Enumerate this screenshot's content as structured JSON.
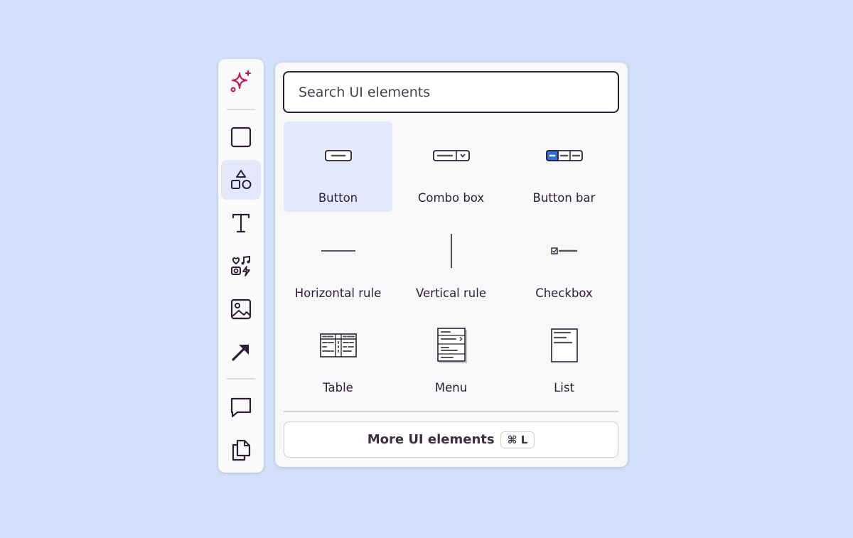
{
  "toolbar": {
    "tools": [
      {
        "name": "ai-sparkle",
        "icon": "sparkle-icon",
        "color": "#c2185b"
      },
      {
        "name": "rectangle",
        "icon": "square-icon"
      },
      {
        "name": "shapes",
        "icon": "shapes-icon",
        "active": true
      },
      {
        "name": "text",
        "icon": "text-icon"
      },
      {
        "name": "stickers",
        "icon": "stickers-icon"
      },
      {
        "name": "image",
        "icon": "image-icon"
      },
      {
        "name": "arrow",
        "icon": "arrow-icon"
      },
      {
        "name": "comment",
        "icon": "comment-icon"
      },
      {
        "name": "duplicate",
        "icon": "copy-icon"
      }
    ]
  },
  "panel": {
    "search_placeholder": "Search UI elements",
    "items": [
      {
        "label": "Button",
        "icon": "button-icon",
        "selected": true
      },
      {
        "label": "Combo box",
        "icon": "combo-box-icon"
      },
      {
        "label": "Button bar",
        "icon": "button-bar-icon"
      },
      {
        "label": "Horizontal rule",
        "icon": "horizontal-rule-icon"
      },
      {
        "label": "Vertical rule",
        "icon": "vertical-rule-icon"
      },
      {
        "label": "Checkbox",
        "icon": "checkbox-icon"
      },
      {
        "label": "Table",
        "icon": "table-icon"
      },
      {
        "label": "Menu",
        "icon": "menu-icon"
      },
      {
        "label": "List",
        "icon": "list-icon"
      }
    ],
    "more_label": "More UI elements",
    "shortcut": "⌘ L"
  },
  "colors": {
    "background": "#d3e0f9",
    "accent": "#2f6fd6",
    "selected": "#e3e8fb",
    "ink": "#2a1f33"
  }
}
